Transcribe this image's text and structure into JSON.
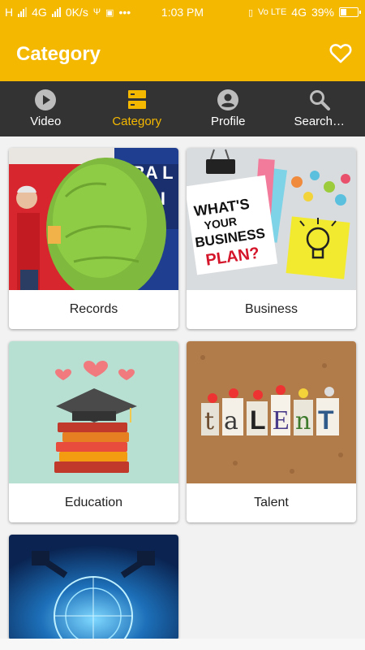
{
  "status": {
    "carrier_left": "H",
    "net_left": "4G",
    "speed": "0K/s",
    "dots": "•••",
    "time": "1:03 PM",
    "volte": "Vo LTE",
    "net_right": "4G",
    "battery": "39%",
    "battery_level": 0.39
  },
  "app_bar": {
    "title": "Category",
    "icon": "heart-outline-icon"
  },
  "tabs": [
    {
      "label": "Video",
      "icon": "play-circle-icon",
      "active": false
    },
    {
      "label": "Category",
      "icon": "list-icon",
      "active": true
    },
    {
      "label": "Profile",
      "icon": "account-circle-icon",
      "active": false
    },
    {
      "label": "Search…",
      "icon": "search-icon",
      "active": false
    }
  ],
  "categories": [
    {
      "label": "Records"
    },
    {
      "label": "Business"
    },
    {
      "label": "Education"
    },
    {
      "label": "Talent"
    },
    {
      "label": ""
    }
  ],
  "images": {
    "records_sign": "BA L  of  FAIN",
    "business_note": [
      "WHAT'S",
      "YOUR",
      "BUSINESS",
      "PLAN?"
    ],
    "talent_word": "taLEnT"
  },
  "colors": {
    "accent": "#f5b800",
    "tab_bg": "#333333"
  }
}
